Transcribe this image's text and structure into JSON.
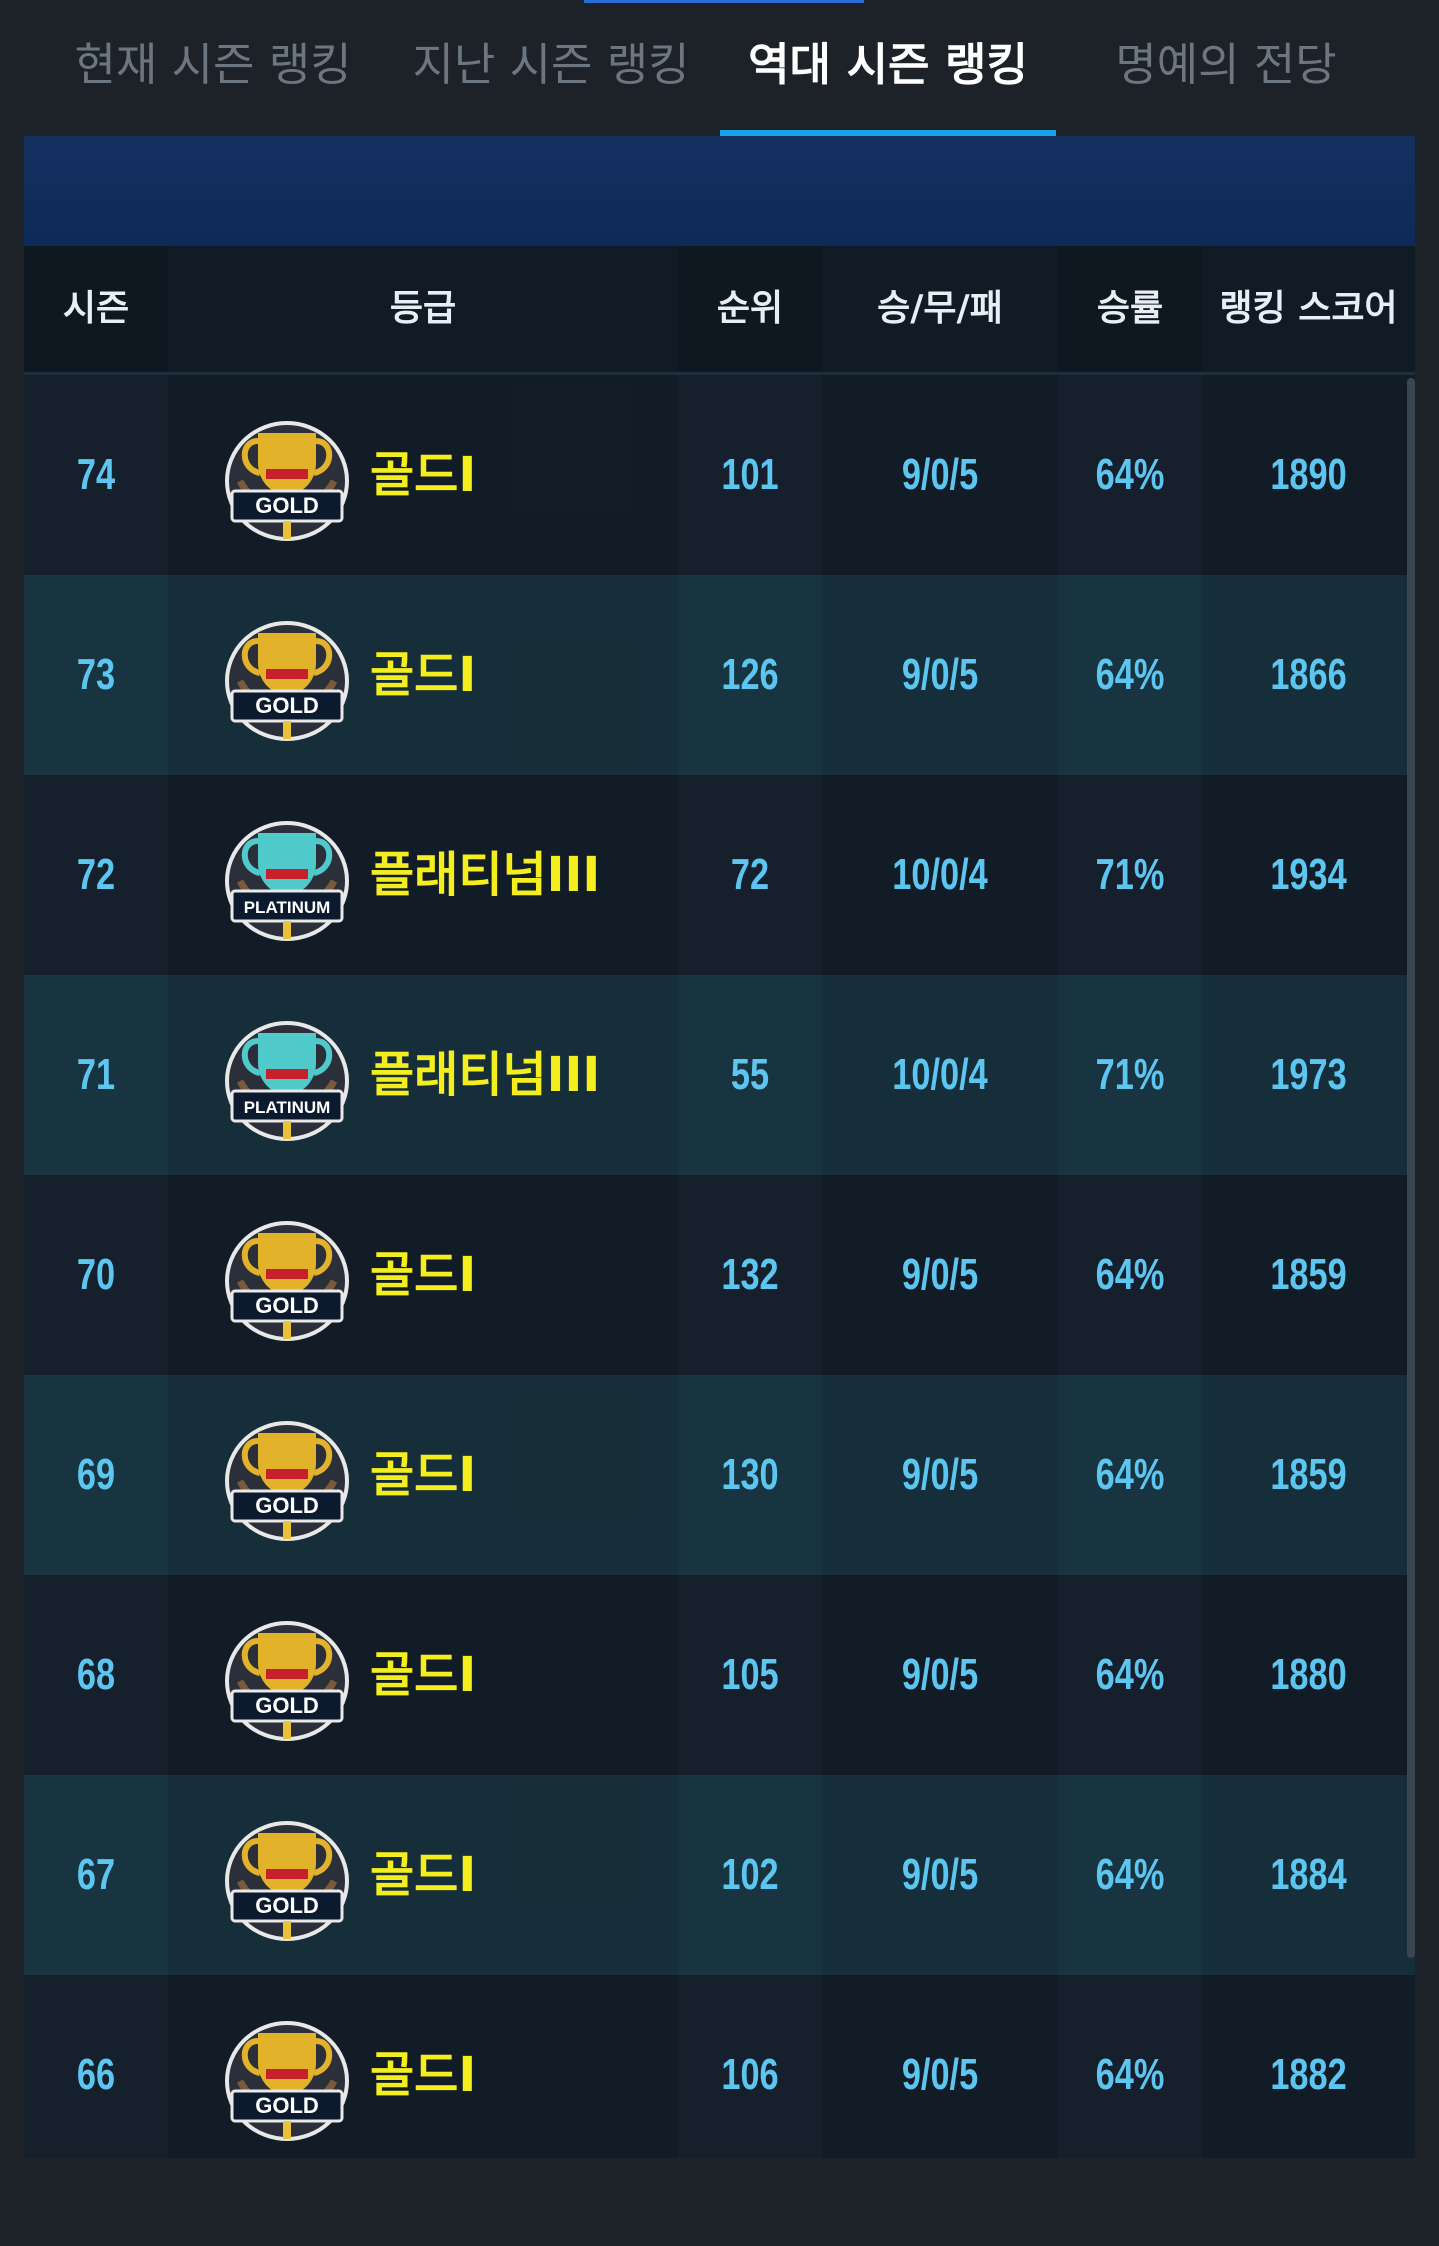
{
  "tabs": [
    {
      "label": "현재 시즌 랭킹",
      "active": false
    },
    {
      "label": "지난 시즌 랭킹",
      "active": false
    },
    {
      "label": "역대 시즌 랭킹",
      "active": true
    },
    {
      "label": "명예의 전당",
      "active": false
    }
  ],
  "table": {
    "headers": {
      "season": "시즌",
      "grade": "등급",
      "rank": "순위",
      "record": "승/무/패",
      "winrate": "승률",
      "score": "랭킹 스코어"
    },
    "rows": [
      {
        "season": "74",
        "grade": "골드I",
        "badge_text": "GOLD",
        "badge_type": "gold",
        "rank": "101",
        "record": "9/0/5",
        "winrate": "64%",
        "score": "1890"
      },
      {
        "season": "73",
        "grade": "골드I",
        "badge_text": "GOLD",
        "badge_type": "gold",
        "rank": "126",
        "record": "9/0/5",
        "winrate": "64%",
        "score": "1866"
      },
      {
        "season": "72",
        "grade": "플래티넘III",
        "badge_text": "PLATINUM",
        "badge_type": "platinum",
        "rank": "72",
        "record": "10/0/4",
        "winrate": "71%",
        "score": "1934"
      },
      {
        "season": "71",
        "grade": "플래티넘III",
        "badge_text": "PLATINUM",
        "badge_type": "platinum",
        "rank": "55",
        "record": "10/0/4",
        "winrate": "71%",
        "score": "1973"
      },
      {
        "season": "70",
        "grade": "골드I",
        "badge_text": "GOLD",
        "badge_type": "gold",
        "rank": "132",
        "record": "9/0/5",
        "winrate": "64%",
        "score": "1859"
      },
      {
        "season": "69",
        "grade": "골드I",
        "badge_text": "GOLD",
        "badge_type": "gold",
        "rank": "130",
        "record": "9/0/5",
        "winrate": "64%",
        "score": "1859"
      },
      {
        "season": "68",
        "grade": "골드I",
        "badge_text": "GOLD",
        "badge_type": "gold",
        "rank": "105",
        "record": "9/0/5",
        "winrate": "64%",
        "score": "1880"
      },
      {
        "season": "67",
        "grade": "골드I",
        "badge_text": "GOLD",
        "badge_type": "gold",
        "rank": "102",
        "record": "9/0/5",
        "winrate": "64%",
        "score": "1884"
      },
      {
        "season": "66",
        "grade": "골드I",
        "badge_text": "GOLD",
        "badge_type": "gold",
        "rank": "106",
        "record": "9/0/5",
        "winrate": "64%",
        "score": "1882"
      }
    ]
  },
  "colors": {
    "tab_active": "#ffffff",
    "tab_inactive": "#6b7681",
    "tab_underline": "#1aa3e6",
    "value_text": "#5cc6f0",
    "grade_text": "#f5ee1f",
    "row_odd": "#15202c",
    "row_even": "#183440",
    "banner": "#0e2a58"
  }
}
